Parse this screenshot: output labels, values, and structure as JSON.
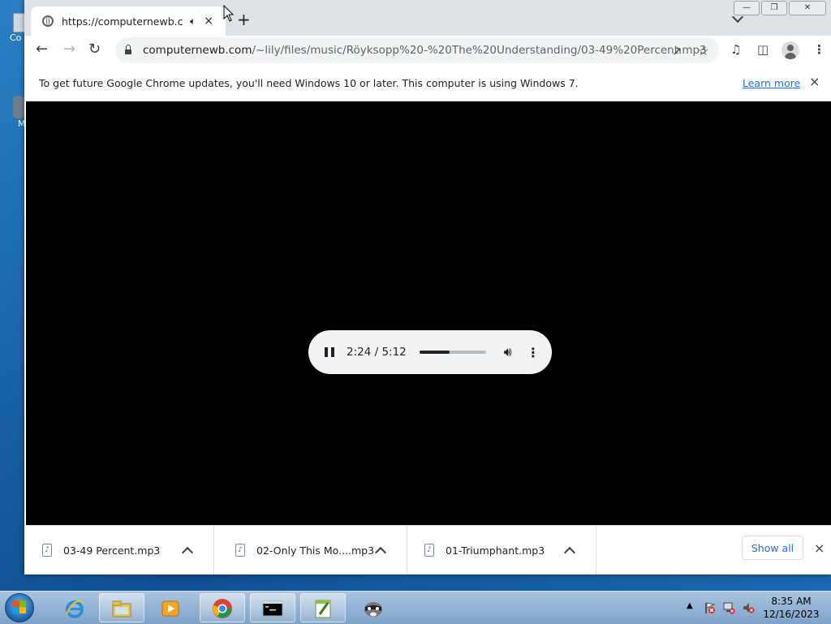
{
  "desktop": {
    "icon_labels": [
      "Co",
      "M"
    ]
  },
  "browser": {
    "tab": {
      "title": "https://computernewb.com/",
      "audio_icon": "speaker-icon",
      "close": "×"
    },
    "new_tab": "+",
    "omnibox": {
      "url_host": "computernewb.com",
      "url_path": "/~lily/files/music/Röyksopp%20-%20The%20Understanding/03-49%20Percent.mp3"
    },
    "infobar": {
      "message": "To get future Google Chrome updates, you'll need Windows 10 or later. This computer is using Windows 7.",
      "link": "Learn more",
      "close": "×"
    },
    "player": {
      "time": "2:24 / 5:12",
      "progress_fraction": 0.46,
      "playing": true
    },
    "downloads": {
      "items": [
        {
          "name": "03-49 Percent.mp3"
        },
        {
          "name": "02-Only This Mo....mp3"
        },
        {
          "name": "01-Triumphant.mp3"
        }
      ],
      "show_all": "Show all",
      "close": "×"
    }
  },
  "taskbar": {
    "apps": [
      "internet-explorer",
      "file-explorer",
      "media-player",
      "chrome",
      "command-prompt",
      "notepad-plus-plus",
      "raccoon-app"
    ],
    "clock": {
      "time": "8:35 AM",
      "date": "12/16/2023"
    }
  },
  "colors": {
    "accent": "#1a73e8",
    "player_bg": "#f1f3f4",
    "video_bg": "#000000"
  }
}
